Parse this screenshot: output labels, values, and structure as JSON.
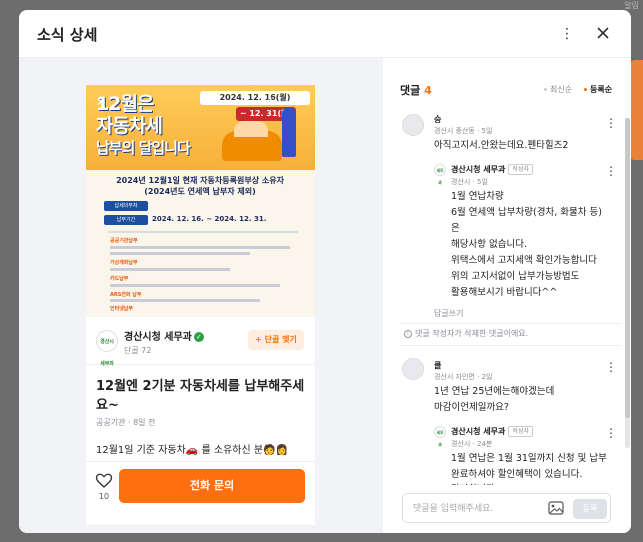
{
  "background": {
    "top_right_text": "알림"
  },
  "modal": {
    "title": "소식 상세",
    "more_icon": "more-vertical-icon",
    "close_icon": "close-icon"
  },
  "poster": {
    "headline_line1": "12월은",
    "headline_line2": "자동차세",
    "headline_line3": "납부의 달입니다",
    "date_range": "2024. 12. 16(월)",
    "date_end": "~ 12. 31(화)",
    "heading": "2024년 12월1일 현재 자동차등록원부상 소유자 (2024년도 연세액 납부자 제외)",
    "label_target": "납세의무자",
    "label_period": "납부기간",
    "period_value": "2024. 12. 16. ~ 2024. 12. 31.",
    "tags": [
      "공공기관납부",
      "가상계좌납부",
      "카드납부",
      "ARS전화 납부",
      "인터넷납부"
    ]
  },
  "profile": {
    "logo_text": "경산시 세무과",
    "name": "경산시청 세무과",
    "sub": "단골 72",
    "follow_label": "+ 단골 맺기"
  },
  "post": {
    "title": "12월엔 2기분 자동차세를 납부해주세요~",
    "meta": "공공기관 · 8일 전",
    "body": "12월1일 기준 자동차🚗 를 소유하신 분🧑👩",
    "like_count": "10",
    "call_label": "전화 문의"
  },
  "comments": {
    "header_label": "댓글",
    "count": "4",
    "sort_latest": "최신순",
    "sort_registered": "등록순",
    "items": [
      {
        "name": "승",
        "meta": "경산시 중산동 · 5일",
        "text": "아직고지서.안왔는데요.펜타힐즈2",
        "reply": {
          "name": "경산시청 세무과",
          "badge": "작성자",
          "meta": "경산시 · 5일",
          "lines": [
            "1월 연납차량",
            "6월 연세액 납부차량(경차, 화물차 등)",
            "은",
            "해당사항 없습니다.",
            "위택스에서 고지세액 확인가능합니다",
            "위의 고지서없이 납부가능방법도",
            "활용해보시기 바랍니다^^"
          ]
        },
        "reply_link": "답글쓰기"
      }
    ],
    "deleted_notice": "댓글 작성자가 삭제한 댓글이에요.",
    "second": {
      "name": "클",
      "meta": "경산시 자인면 · 2일",
      "lines": [
        "1년 연납 25년에는해야겠는데",
        "마감이언제일까요?"
      ],
      "reply": {
        "name": "경산시청 세무과",
        "badge": "작성자",
        "meta": "경산시 · 24분",
        "lines": [
          "1월 연납은 1월 31일까지 신청 및 납부",
          "완료하셔야 할인혜택이 있습니다.",
          "감사합니다"
        ]
      }
    },
    "input_placeholder": "댓글을 입력해주세요.",
    "submit_label": "등록"
  },
  "colors": {
    "accent": "#ff6f0f",
    "verified": "#2f9e44"
  }
}
